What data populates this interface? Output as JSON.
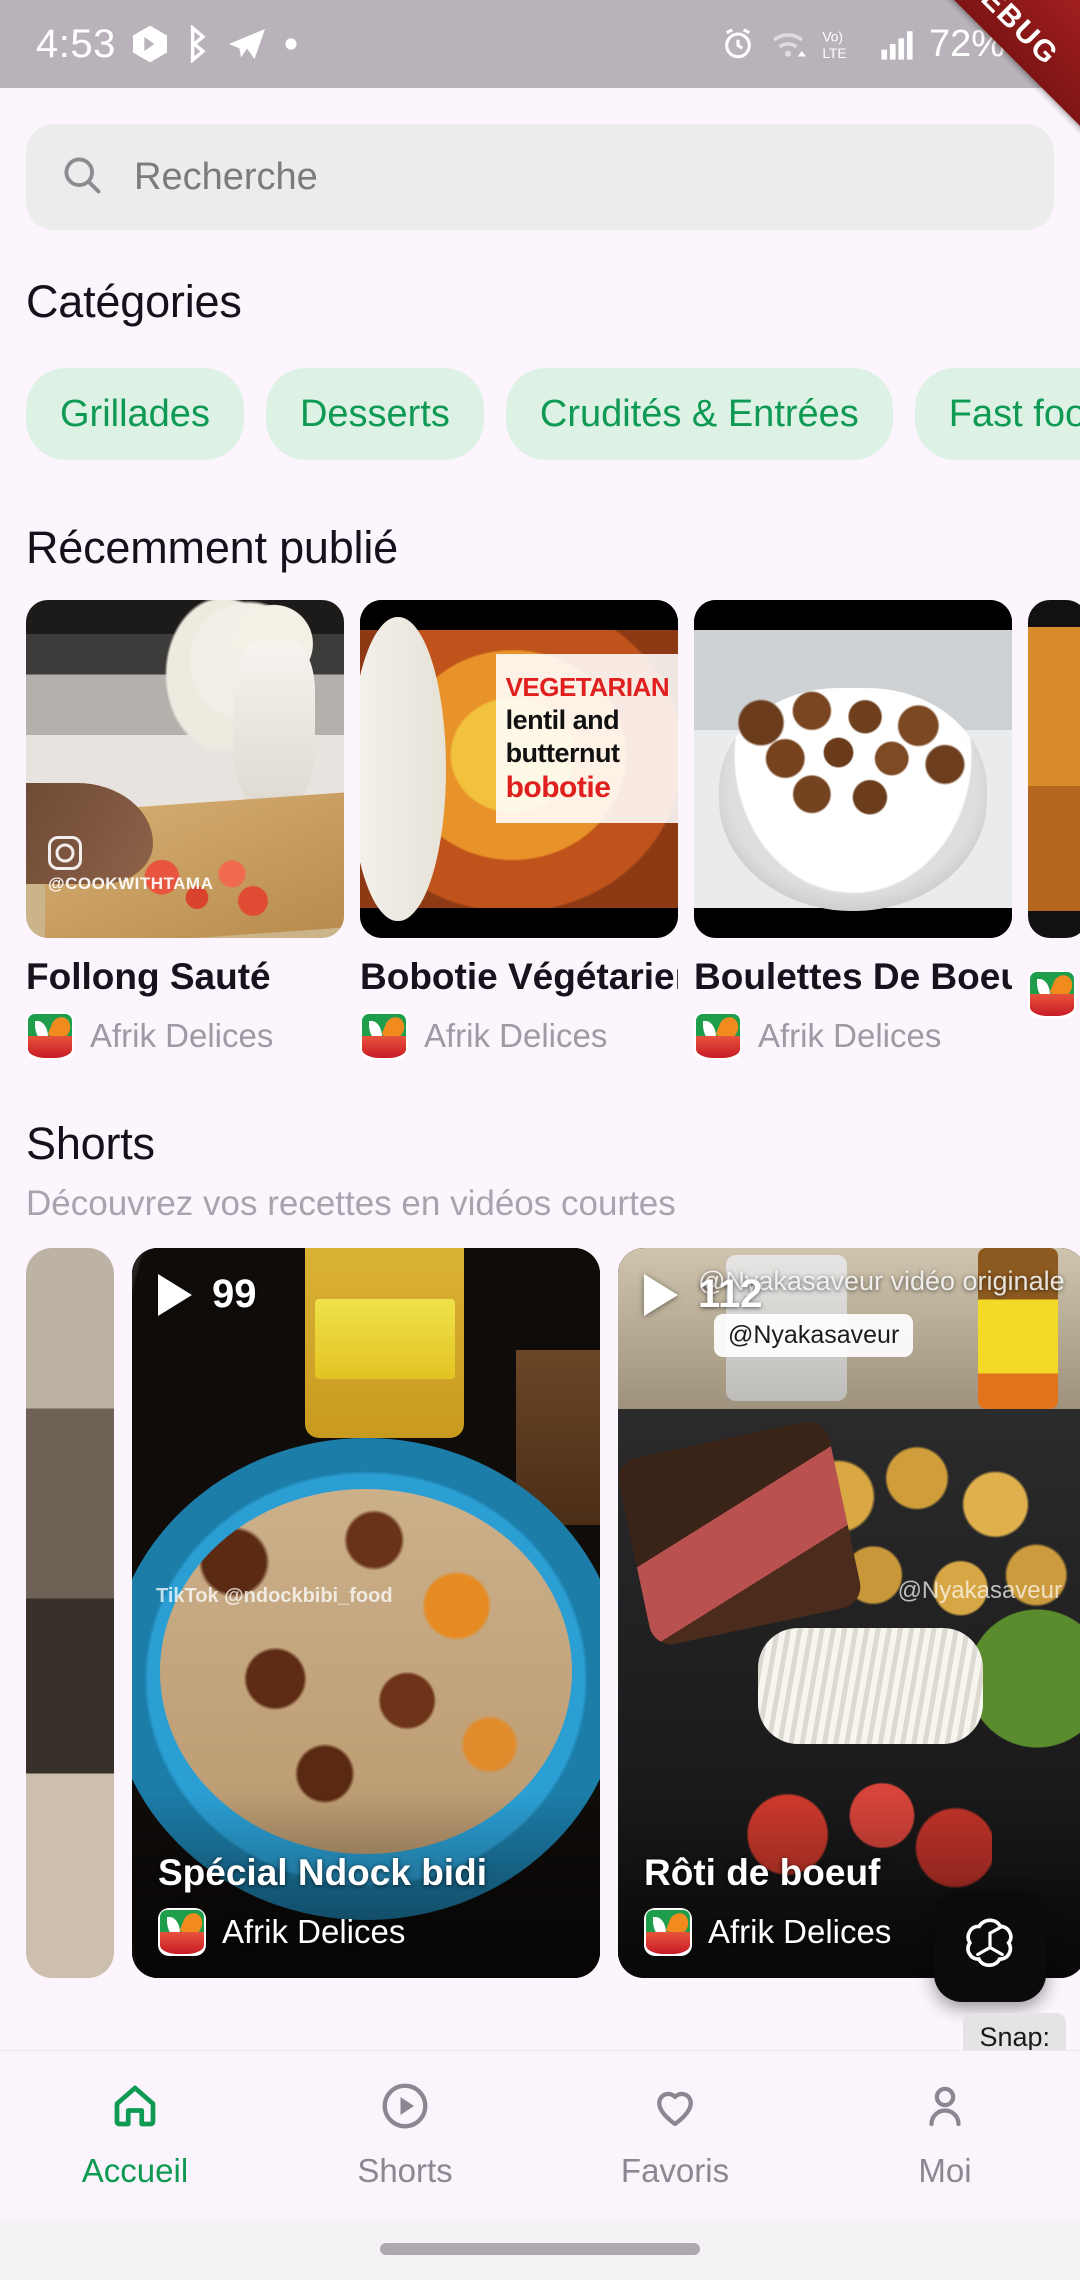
{
  "status_bar": {
    "time": "4:53",
    "battery_percent": "72%",
    "network_label": "LTE",
    "voice_label": "Vo)",
    "icons": [
      "app-badge-icon",
      "bluetooth-audio-icon",
      "telegram-icon",
      "dot-icon",
      "alarm-icon",
      "wifi-icon",
      "volte-icon",
      "signal-icon",
      "battery-icon"
    ],
    "debug_banner": "DEBUG"
  },
  "search": {
    "placeholder": "Recherche",
    "icon": "search-icon"
  },
  "categories": {
    "heading": "Catégories",
    "items": [
      {
        "label": "Grillades"
      },
      {
        "label": "Desserts"
      },
      {
        "label": "Crudités & Entrées"
      },
      {
        "label": "Fast food"
      },
      {
        "label": ""
      }
    ]
  },
  "recent": {
    "heading": "Récemment publié",
    "cards": [
      {
        "title": "Follong Sauté",
        "author": "Afrik Delices",
        "watermark": "@COOKWITHTAMA"
      },
      {
        "title": "Bobotie Végétarien",
        "author": "Afrik Delices",
        "overlay": {
          "l1": "VEGETARIAN",
          "l2": "lentil and",
          "l3": "butternut",
          "l4": "bobotie"
        }
      },
      {
        "title": "Boulettes De Boeuf",
        "author": "Afrik Delices"
      },
      {
        "title": "",
        "author": ""
      }
    ]
  },
  "shorts": {
    "heading": "Shorts",
    "subtitle": "Découvrez vos recettes en vidéos courtes",
    "cards": [
      {
        "title": "",
        "author": "",
        "plays": ""
      },
      {
        "title": "Spécial Ndock bidi",
        "author": "Afrik Delices",
        "plays": "99",
        "watermark": "TikTok\n@ndockbibi_food"
      },
      {
        "title": "Rôti de boeuf",
        "author": "Afrik Delices",
        "plays": "112",
        "watermark_top": "@Nyakasaveur vidéo originale",
        "badge": "@Nyakasaveur",
        "watermark_mid": "@Nyakasaveur"
      }
    ]
  },
  "fab": {
    "name": "chatgpt-button",
    "snap_label": "Snap:"
  },
  "bottom_nav": {
    "items": [
      {
        "label": "Accueil",
        "icon": "home-icon",
        "active": true
      },
      {
        "label": "Shorts",
        "icon": "play-circle-icon",
        "active": false
      },
      {
        "label": "Favoris",
        "icon": "heart-icon",
        "active": false
      },
      {
        "label": "Moi",
        "icon": "person-icon",
        "active": false
      }
    ]
  },
  "colors": {
    "accent_green": "#0E9A53",
    "chip_bg": "#DDF2E4",
    "page_bg": "#FCF5FD",
    "status_bar_bg": "#B9B2BA",
    "debug_red": "#A62020"
  }
}
